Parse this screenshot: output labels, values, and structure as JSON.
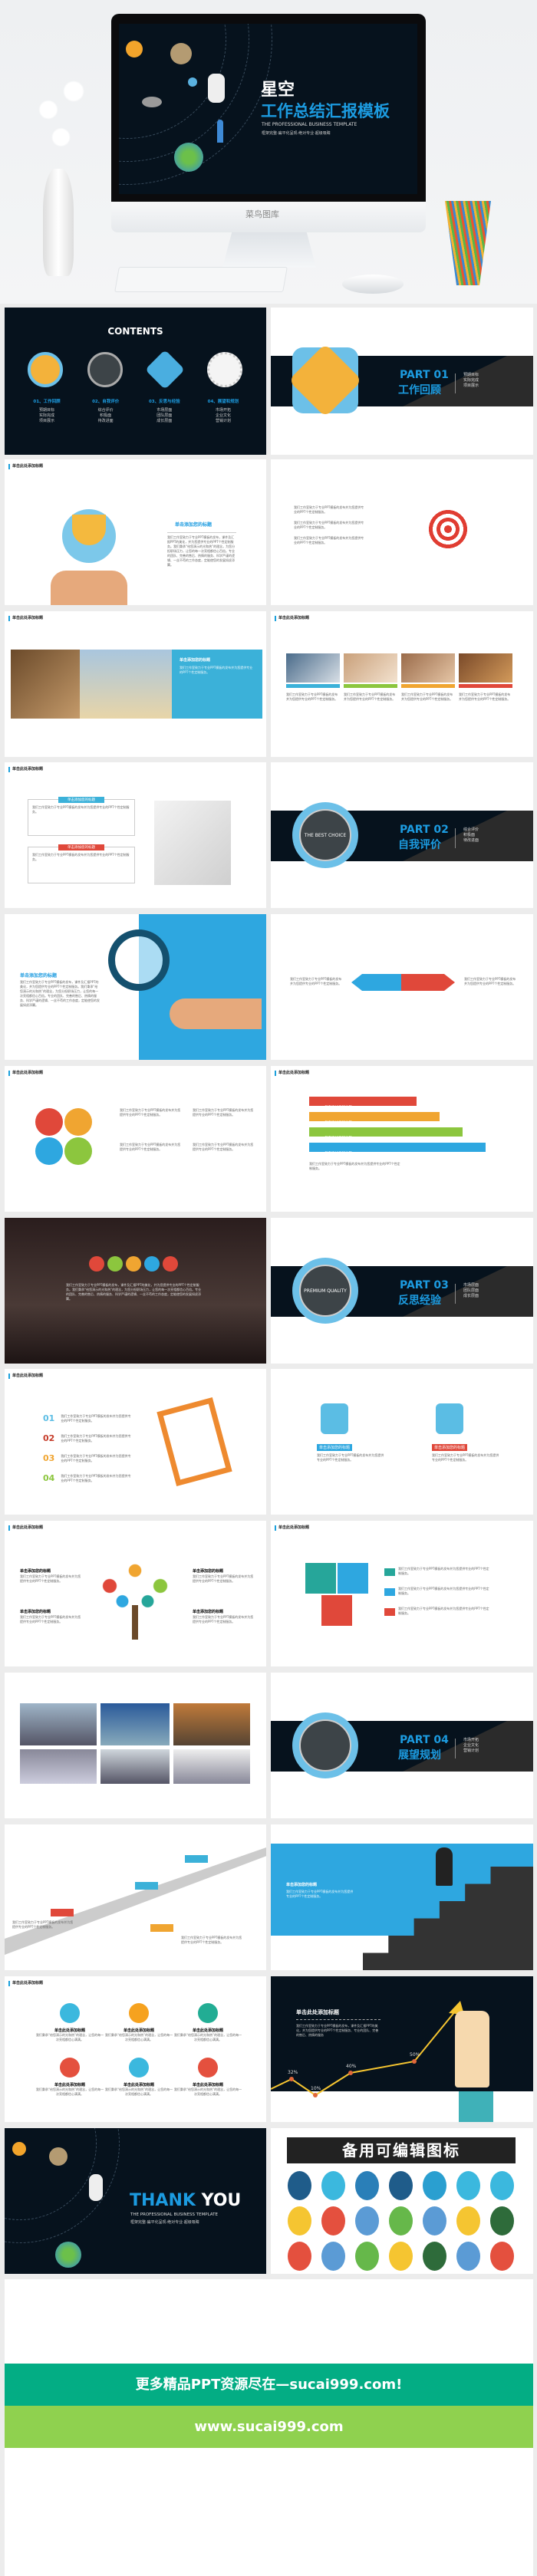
{
  "hero": {
    "title1": "星空",
    "title2": "工作总结汇报模板",
    "en": "THE PROFESSIONAL BUSINESS TEMPLATE",
    "sub": "框架完整·扁平化呈现·绝对专业·超级吸睛",
    "brand": "菜鸟图库"
  },
  "contents": {
    "title": "CONTENTS",
    "sections": [
      {
        "label": "01、工作回顾",
        "items": [
          "预期目标",
          "实际完成",
          "项目展示"
        ]
      },
      {
        "label": "02、自我评价",
        "items": [
          "综合评价",
          "积极面",
          "待改进面"
        ]
      },
      {
        "label": "03、反思与经验",
        "items": [
          "市场层面",
          "团队层面",
          "成长层面"
        ]
      },
      {
        "label": "04、展望和规划",
        "items": [
          "市场开拓",
          "企业文化",
          "营销计划"
        ]
      }
    ]
  },
  "parts": [
    {
      "num": "PART 01",
      "title": "工作回顾",
      "items": [
        "预期目标",
        "实际完成",
        "项目展示"
      ]
    },
    {
      "num": "PART 02",
      "title": "自我评价",
      "items": [
        "综合评价",
        "积极面",
        "待改进面"
      ]
    },
    {
      "num": "PART 03",
      "title": "反思经验",
      "items": [
        "市场层面",
        "团队层面",
        "成长层面"
      ]
    },
    {
      "num": "PART 04",
      "title": "展望规划",
      "items": [
        "市场开拓",
        "企业文化",
        "营销计划"
      ]
    }
  ],
  "badge": {
    "top": "THE BEST CHOICE",
    "bottom": "PREMIUM QUALITY"
  },
  "common": {
    "slide_title": "单击此处添加标题",
    "add_title": "单击添加您的标题",
    "body": "我们工作室致力于专业PPT模板的发布，课件及汇报PPT的美化，并为您提供专业的PPT个性定制服务。我们秉承“给您演示的光和热”的理念，为您分担职场压力，让您的每一次亮相都信心百倍。专业的团队、完善的售后、热情的服务、科学严谨的逻辑、一丝不苟的工作态度，定能使您的发展如虎添翼。",
    "short": "我们工作室致力于专业PPT模板的发布并为您提供专业的PPT个性定制服务。",
    "card": "我们秉承“给您演示的光和热”的理念，让您的每一次亮相都信心满满。",
    "chart_body": "我们工作室致力于专业PPT模板的发布，课件及汇报PPT的美化，并为您提供专业的PPT个性定制服务、专业的团队、完善的售后、热情的服务"
  },
  "numbers": [
    "01",
    "02",
    "03",
    "04"
  ],
  "number_colors": [
    "#5bbde4",
    "#c63c2a",
    "#f0a531",
    "#8cc63e"
  ],
  "chart_data": {
    "type": "line",
    "values": [
      "32%",
      "10%",
      "40%",
      "50%"
    ]
  },
  "thanks": {
    "a": "THANK",
    "b": "YOU",
    "en": "THE PROFESSIONAL BUSINESS TEMPLATE",
    "sub": "框架完整·扁平化呈现·绝对专业·超级吸睛"
  },
  "icons": {
    "title": "备用可编辑图标"
  },
  "footer": {
    "line1": "更多精品PPT资源尽在—sucai999.com!",
    "line2": "www.sucai999.com"
  },
  "colors": {
    "accent": "#1c9be0",
    "dark": "#06121d",
    "green1": "#03ad84",
    "green2": "#8fd14f"
  }
}
